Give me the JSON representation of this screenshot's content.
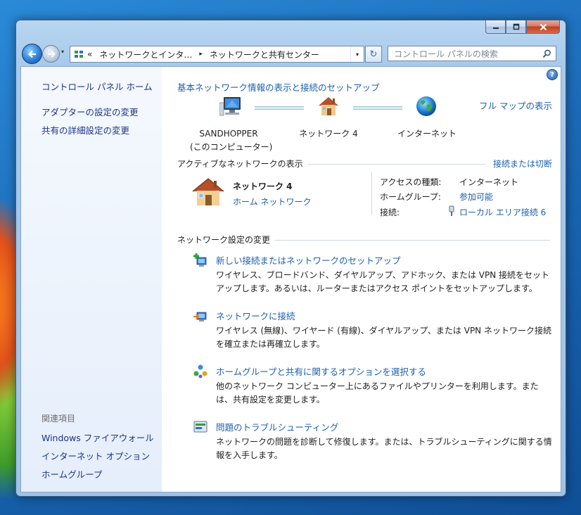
{
  "colors": {
    "link": "#1c5fae",
    "sidebar_link": "#1e3287",
    "window_frame": "#a7c9ea"
  },
  "window": {
    "caption_buttons": [
      "minimize-icon",
      "maximize-icon",
      "close-icon"
    ]
  },
  "navbar": {
    "recent_glyph": "▾",
    "address": {
      "overflow": "«",
      "crumbs": [
        "ネットワークとインタ…",
        "ネットワークと共有センター"
      ],
      "separator": "▸",
      "dropdown": "▾"
    },
    "refresh_glyph": "↻",
    "search_placeholder": "コントロール パネルの検索"
  },
  "sidebar": {
    "home": "コントロール パネル ホーム",
    "items": [
      "アダプターの設定の変更",
      "共有の詳細設定の変更"
    ],
    "related_heading": "関連項目",
    "related": [
      "Windows ファイアウォール",
      "インターネット オプション",
      "ホームグループ"
    ]
  },
  "main": {
    "help": "?",
    "title": "基本ネットワーク情報の表示と接続のセットアップ",
    "full_map": "フル マップの表示",
    "map": {
      "computer_name": "SANDHOPPER",
      "computer_sub": "(このコンピューター)",
      "network": "ネットワーク 4",
      "internet": "インターネット"
    },
    "active": {
      "heading": "アクティブなネットワークの表示",
      "connect_link": "接続または切断",
      "name": "ネットワーク 4",
      "type_link": "ホーム ネットワーク",
      "props": [
        {
          "label": "アクセスの種類:",
          "value": "インターネット",
          "is_link": false
        },
        {
          "label": "ホームグループ:",
          "value": "参加可能",
          "is_link": true
        },
        {
          "label": "接続:",
          "value": "ローカル エリア接続 6",
          "is_link": true
        }
      ]
    },
    "settings": {
      "heading": "ネットワーク設定の変更",
      "tasks": [
        {
          "icon": "new-connection-icon",
          "title": "新しい接続またはネットワークのセットアップ",
          "desc": "ワイヤレス、ブロードバンド、ダイヤルアップ、アドホック、または VPN 接続をセットアップします。あるいは、ルーターまたはアクセス ポイントをセットアップします。"
        },
        {
          "icon": "connect-network-icon",
          "title": "ネットワークに接続",
          "desc": "ワイヤレス (無線)、ワイヤード (有線)、ダイヤルアップ、または VPN ネットワーク接続を確立または再確立します。"
        },
        {
          "icon": "homegroup-icon",
          "title": "ホームグループと共有に関するオプションを選択する",
          "desc": "他のネットワーク コンピューター上にあるファイルやプリンターを利用します。または、共有設定を変更します。"
        },
        {
          "icon": "troubleshoot-icon",
          "title": "問題のトラブルシューティング",
          "desc": "ネットワークの問題を診断して修復します。または、トラブルシューティングに関する情報を入手します。"
        }
      ]
    }
  }
}
